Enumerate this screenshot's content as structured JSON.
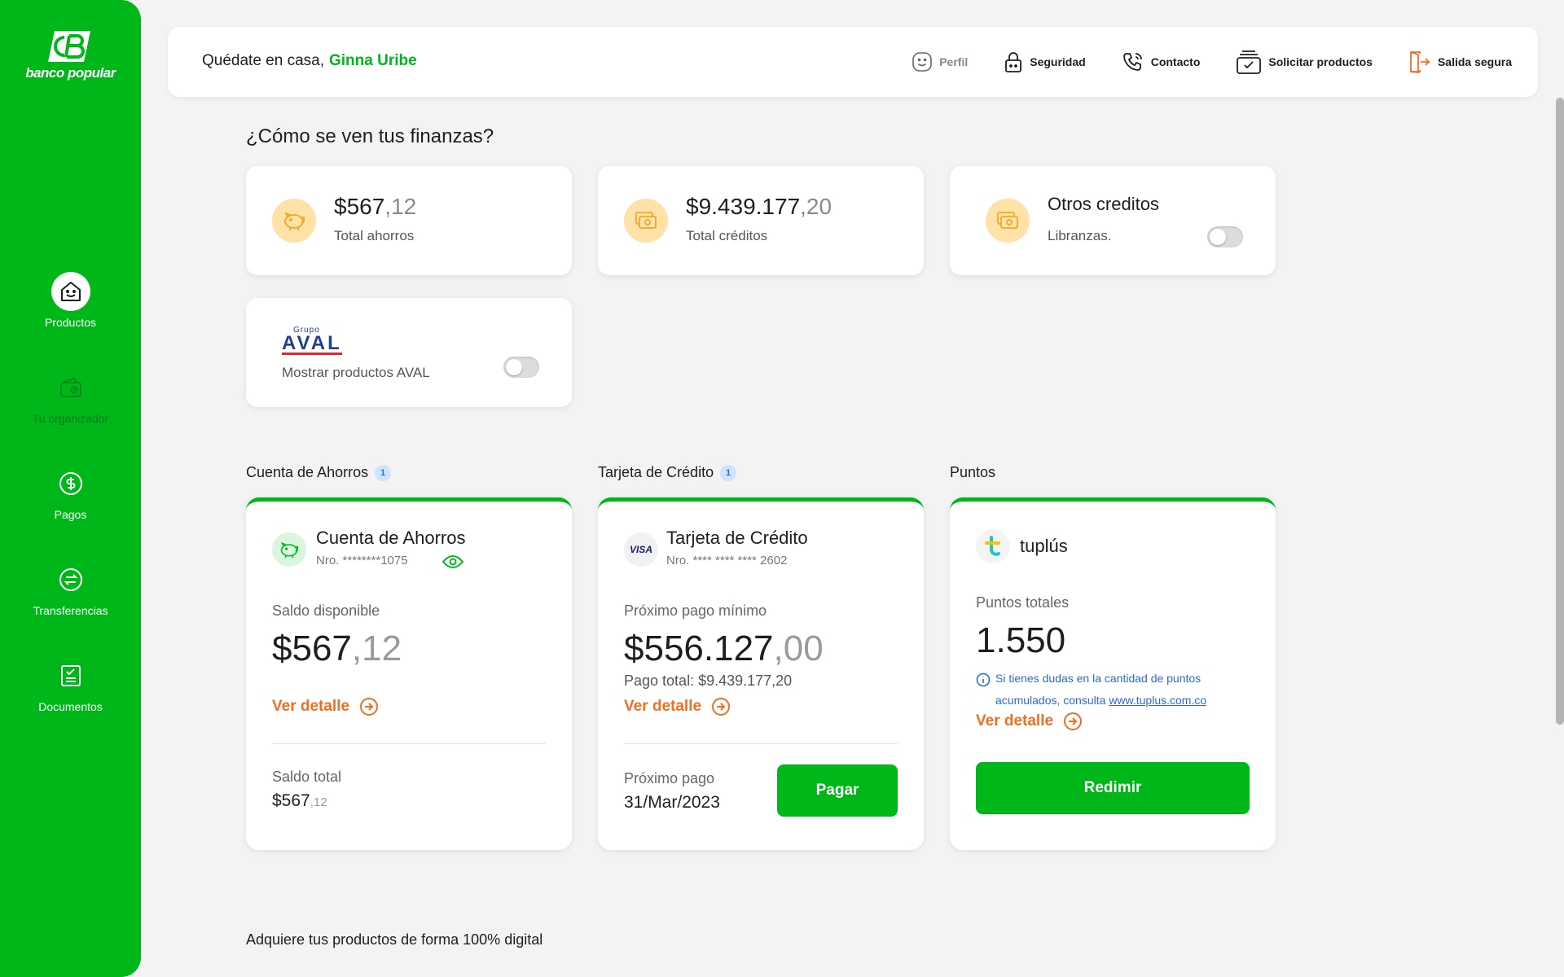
{
  "brand": {
    "name": "banco popular",
    "color": "#00b71a"
  },
  "sidebar": {
    "items": [
      {
        "label": "Productos",
        "icon": "house-icon",
        "active": true
      },
      {
        "label": "Tu organizador",
        "icon": "wallet-icon",
        "active": false
      },
      {
        "label": "Pagos",
        "icon": "dollar-circle-icon",
        "active": false
      },
      {
        "label": "Transferencias",
        "icon": "transfer-icon",
        "active": false
      },
      {
        "label": "Documentos",
        "icon": "document-check-icon",
        "active": false
      }
    ]
  },
  "header": {
    "greeting": "Quédate en casa,",
    "user_name": "Ginna Uribe",
    "nav": [
      {
        "label": "Perfil",
        "icon": "smile-icon"
      },
      {
        "label": "Seguridad",
        "icon": "lock-icon"
      },
      {
        "label": "Contacto",
        "icon": "phone-icon"
      },
      {
        "label": "Solicitar productos",
        "icon": "card-stack-icon"
      },
      {
        "label": "Salida segura",
        "icon": "exit-icon"
      }
    ]
  },
  "summary": {
    "title": "¿Cómo se ven tus finanzas?",
    "ahorros": {
      "amount": "$567",
      "decimals": ",12",
      "label": "Total ahorros"
    },
    "creditos": {
      "amount": "$9.439.177",
      "decimals": ",20",
      "label": "Total créditos"
    },
    "otros": {
      "title": "Otros creditos",
      "label": "Libranzas."
    },
    "aval": {
      "brand_small": "Grupo",
      "brand": "AVAL",
      "label": "Mostrar productos AVAL"
    }
  },
  "products": {
    "savings": {
      "section_label": "Cuenta de Ahorros",
      "count": "1",
      "title": "Cuenta de Ahorros",
      "number": "Nro. ********1075",
      "available_label": "Saldo disponible",
      "available_amount": "$567",
      "available_decimals": ",12",
      "detail_link": "Ver detalle",
      "total_label": "Saldo total",
      "total_amount": "$567",
      "total_decimals": ",12"
    },
    "credit_card": {
      "section_label": "Tarjeta de Crédito",
      "count": "1",
      "title": "Tarjeta de Crédito",
      "number": "Nro. **** **** **** 2602",
      "network": "VISA",
      "min_payment_label": "Próximo pago mínimo",
      "min_payment_amount": "$556.127",
      "min_payment_decimals": ",00",
      "total_payment": "Pago total: $9.439.177,20",
      "detail_link": "Ver detalle",
      "next_payment_label": "Próximo pago",
      "next_payment_date": "31/Mar/2023",
      "pay_button": "Pagar"
    },
    "points": {
      "section_label": "Puntos",
      "brand": "tuplús",
      "total_label": "Puntos totales",
      "total_value": "1.550",
      "info_text": "Si tienes dudas en la cantidad de puntos acumulados, consulta",
      "info_link": "www.tuplus.com.co",
      "detail_link": "Ver detalle",
      "redeem_button": "Redimir"
    }
  },
  "footer": {
    "text": "Adquiere tus productos de forma 100% digital"
  },
  "colors": {
    "accent": "#00b71a",
    "orange": "#f26e21",
    "info_blue": "#2a6bd0",
    "icon_bg": "#ffe2a8"
  }
}
